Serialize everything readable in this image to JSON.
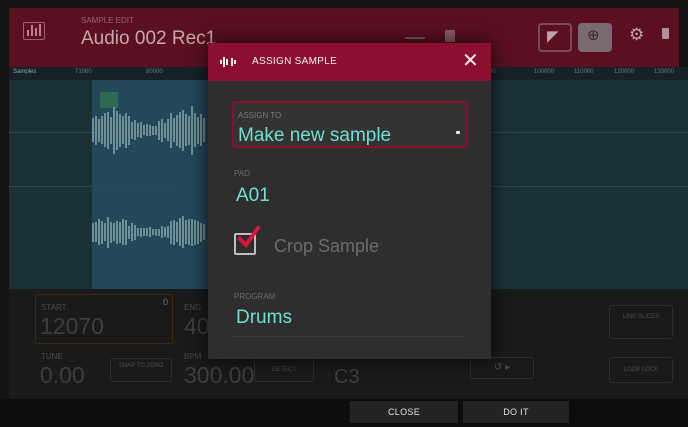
{
  "header": {
    "title": "Audio 002 Rec1",
    "subtitle": "SAMPLE EDIT",
    "icons": [
      "waveform-icon",
      "headphones-icon",
      "zoom-icon",
      "gear-icon",
      "trash-icon"
    ]
  },
  "ruler": {
    "section_label": "Samples",
    "ticks": [
      "71060",
      "80000",
      "90000",
      "100000",
      "110000",
      "120000",
      "130000"
    ]
  },
  "controls": {
    "start": {
      "label": "START",
      "value": "12070",
      "badge": "0"
    },
    "end": {
      "label": "END",
      "value": "40"
    },
    "tune": {
      "label": "TUNE",
      "value": "0.00"
    },
    "bpm": {
      "label": "BPM",
      "value": "300.00"
    },
    "root": {
      "value": "C3"
    },
    "snap_button": "SNAP TO ZERO",
    "detect_button": "DETECT",
    "link_slices": "LINK SLICES",
    "loop_lock": "LOOP LOCK"
  },
  "modal": {
    "title": "ASSIGN SAMPLE",
    "assign_to": {
      "label": "ASSIGN TO",
      "value": "Make new sample"
    },
    "pad": {
      "label": "PAD",
      "value": "A01"
    },
    "crop": {
      "label": "Crop Sample",
      "checked": true
    },
    "program": {
      "label": "PROGRAM",
      "value": "Drums"
    }
  },
  "footer": {
    "close_label": "CLOSE",
    "do_it_label": "DO IT"
  },
  "colors": {
    "accent": "#8c0f2f",
    "value_text": "#6fe0d3",
    "check": "#d8173d"
  }
}
